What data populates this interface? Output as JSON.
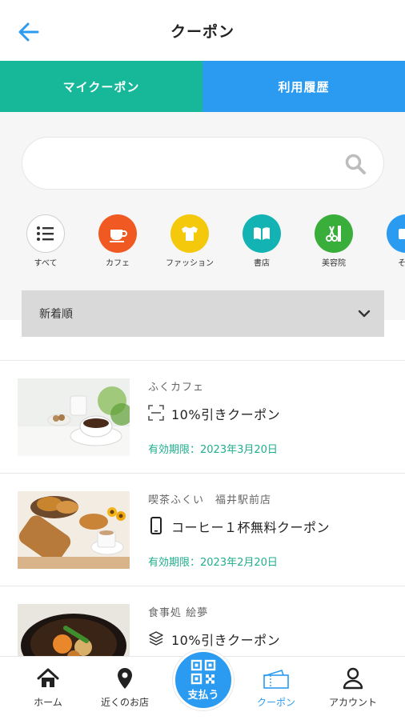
{
  "header": {
    "title": "クーポン",
    "back_icon": "arrow-left-icon"
  },
  "tabs": [
    {
      "label": "マイクーポン",
      "active": true
    },
    {
      "label": "利用履歴",
      "active": false
    }
  ],
  "search": {
    "value": "",
    "placeholder": ""
  },
  "categories": [
    {
      "label": "すべて",
      "icon": "list-icon",
      "color": "#ffffff"
    },
    {
      "label": "カフェ",
      "icon": "coffee-cup-icon",
      "color": "#f05a22"
    },
    {
      "label": "ファッション",
      "icon": "tshirt-icon",
      "color": "#f4c90c"
    },
    {
      "label": "書店",
      "icon": "book-icon",
      "color": "#13b3b3"
    },
    {
      "label": "美容院",
      "icon": "scissors-comb-icon",
      "color": "#3aae3a"
    },
    {
      "label": "その",
      "icon": "more-icon",
      "color": "#2a9bf0"
    }
  ],
  "sort": {
    "selected": "新着順"
  },
  "coupons": [
    {
      "shop": "ふくカフェ",
      "type_icon": "scan-icon",
      "title": "10%引きクーポン",
      "expiry": "有効期限：2023年3月20日"
    },
    {
      "shop": "喫茶ふくい　福井駅前店",
      "type_icon": "smartphone-icon",
      "title": "コーヒー１杯無料クーポン",
      "expiry": "有効期限：2023年2月20日"
    },
    {
      "shop": "食事処 絵夢",
      "type_icon": "layers-icon",
      "title": "10%引きクーポン",
      "expiry": ""
    }
  ],
  "bottom_nav": {
    "home": "ホーム",
    "nearby": "近くのお店",
    "pay": "支払う",
    "coupon": "クーポン",
    "account": "アカウント"
  },
  "colors": {
    "accent_green": "#17b89a",
    "accent_blue": "#2a9bf0",
    "expiry_green": "#1fae8e"
  }
}
